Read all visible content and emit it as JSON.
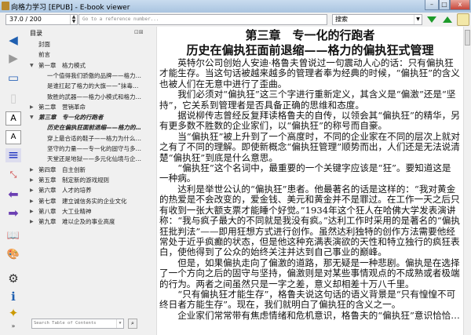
{
  "window": {
    "title": "向格力学习 [EPUB] - E-book viewer",
    "minimize": "–",
    "maximize": "□",
    "close": "x"
  },
  "toolbar": {
    "position": "37.0 / 200",
    "reference_placeholder": "Go to a reference number...",
    "search_placeholder": "搜索"
  },
  "toc": {
    "header": "目录",
    "items": [
      {
        "label": "封面",
        "level": 1
      },
      {
        "label": "前言",
        "level": 1
      },
      {
        "label": "第一章　格力模式",
        "level": 1,
        "expanded": true
      },
      {
        "label": "一个值得我们骄傲的品牌——格力…",
        "level": 2
      },
      {
        "label": "是谁扛起了格力的大旗——“抹毒…",
        "level": 2
      },
      {
        "label": "致胜的武器——格力小模式和格力…",
        "level": 2
      },
      {
        "label": "第二章　营销革命",
        "level": 1,
        "expanded": false
      },
      {
        "label": "第三章　专一化的行跑者",
        "level": 1,
        "expanded": true,
        "current": true
      },
      {
        "label": "历史在偏执狂面前退缩——格力的…",
        "level": 2,
        "current": true
      },
      {
        "label": "穿上最合适的鞋子——格力为什么…",
        "level": 2
      },
      {
        "label": "坚守的力量——专一化的固守与多…",
        "level": 2
      },
      {
        "label": "天堂还是地狱——多元化仙境与企…",
        "level": 2
      },
      {
        "label": "第四章　自主创新",
        "level": 1,
        "expanded": false
      },
      {
        "label": "第五章　制定新的游戏规则",
        "level": 1,
        "expanded": false
      },
      {
        "label": "第六章　人才的培养",
        "level": 1,
        "expanded": false
      },
      {
        "label": "第七章　建立诚信务实的企业文化",
        "level": 1,
        "expanded": false
      },
      {
        "label": "第八章　大工业精神",
        "level": 1,
        "expanded": false
      },
      {
        "label": "第九章　难以企及的事业高度",
        "level": 1,
        "expanded": false
      }
    ],
    "search_placeholder": "Search Table of Contents"
  },
  "content": {
    "chapter_title": "第三章　专一化的行跑者",
    "section_title": "历史在偏执狂面前退缩——格力的偏执狂式管理",
    "paragraphs": [
      "英特尔公司创始人安迪·格鲁夫曾说过一句震动人心的话：只有偏执狂才能生存。当这句话被越来越多的管理者奉为经典的时候，“偏执狂”的含义也被人们在无意中进行了歪曲。",
      "我们必须对“偏执狂”这三个字进行重新定义，其含义是“偏激”还是“坚持”，它关系到管理者是否具备正确的思维和态度。",
      "据说柳传志曾经反复拜读格鲁夫的自传，以领会其“偏执狂”的精华，另有更多数不胜数的企业家们，以“偏执狂”的称号而自豪。",
      "当“偏执狂”被上升到了一个高度时，不同的企业家在不同的层次上就对之有了不同的理解。即使新概念“偏执狂管理”顺势而出，人们还是无法说清楚“偏执狂”到底是什么意思。",
      "“偏执狂”这个名词中，最重要的一个关键字应该是“狂”。要知道这是一种病。",
      "达利是举世公认的“偏执狂”患者。他最著名的话是这样的：“我对黄金的热爱是不会改变的，爱金钱、美元和黄金并不是罪过。在工作一天之后只有收到一张大额支票才能睡个好觉。”1934年这个狂人在哈佛大学发表演讲称：“我与疯子最大的不同就是我没有疯。”达利工作时采用的是著名的“偏执狂批判法”——即用狂想方式进行创作。虽然达利独特的创作方法需要他经常处于近乎疯癫的状态，但是他这种充满表演欲的天性和特立独行的疯狂表白，使他得到了公众的始终关注并达到自己事业的巅峰。",
      "但是，如果偏执走向了偏激的道路，那无疑是一种悲剧。偏执是在选择了一个方向之后的固守与坚持，偏激则是对某些事情观点的不成熟或者极端的行为。两者之间虽然只是一字之差，意义却相差十万八千里。",
      "“只有偏执狂才能生存”，格鲁夫说这句话的语义背景是“只有惶惶不可终日者方能生存”。现在，我们就明白了偏执狂的含义之一。",
      "企业家们常常带有焦虑情绪和危机意识，格鲁夫的“偏执狂”意识恰恰…"
    ]
  },
  "colors": {
    "nav_arrow": "#1f5fb0",
    "green_arrow": "#1d9b2a",
    "purple": "#6b3fb3"
  }
}
